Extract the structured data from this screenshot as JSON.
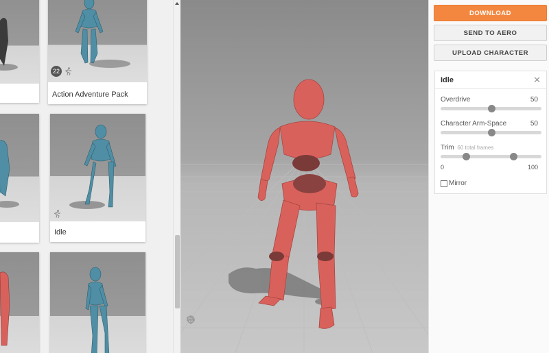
{
  "gallery": {
    "cards": [
      {
        "id": "action-adventure-pack",
        "title": "Action Adventure Pack",
        "badge_count": "22",
        "has_badge": true
      },
      {
        "id": "idle",
        "title": "Idle",
        "has_badge": false
      },
      {
        "id": "unnamed",
        "title": "",
        "has_badge": false
      }
    ]
  },
  "actions": {
    "download_label": "DOWNLOAD",
    "send_label": "SEND TO AERO",
    "upload_label": "UPLOAD CHARACTER"
  },
  "settings": {
    "title": "Idle",
    "close_glyph": "✕",
    "overdrive": {
      "label": "Overdrive",
      "value": 50,
      "display": "50"
    },
    "arm_space": {
      "label": "Character Arm-Space",
      "value": 50,
      "display": "50"
    },
    "trim": {
      "label": "Trim",
      "sub": "60 total frames",
      "min": 0,
      "max": 100,
      "min_label": "0",
      "max_label": "100",
      "start": 25,
      "end": 72
    },
    "mirror": {
      "label": "Mirror",
      "checked": false
    }
  },
  "colors": {
    "accent": "#f4873f",
    "character": "#d9615c",
    "character_dark": "#7a3a38",
    "thumb_character": "#4f8ea4"
  },
  "icons": {
    "badge": "badge-count",
    "run": "running-figure-icon",
    "close": "close-icon",
    "tools": [
      "skull-icon",
      "undo-icon",
      "move-icon"
    ]
  }
}
